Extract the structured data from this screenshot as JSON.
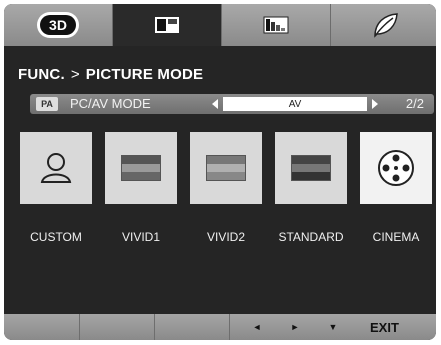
{
  "tabs": [
    {
      "icon": "3d-icon",
      "label": "3D",
      "active": false
    },
    {
      "icon": "picture-icon",
      "active": true
    },
    {
      "icon": "color-bars-icon",
      "active": false
    },
    {
      "icon": "eco-leaf-icon",
      "active": false
    }
  ],
  "breadcrumb": {
    "parent": "FUNC.",
    "separator": ">",
    "current": "PICTURE MODE"
  },
  "mode_row": {
    "badge": "PA",
    "label": "PC/AV MODE",
    "value": "AV",
    "page": "2/2"
  },
  "modes": [
    {
      "label": "CUSTOM",
      "icon": "person-icon",
      "selected": false
    },
    {
      "label": "VIVID1",
      "icon": "vivid1-swatch-icon",
      "selected": false
    },
    {
      "label": "VIVID2",
      "icon": "vivid2-swatch-icon",
      "selected": false
    },
    {
      "label": "STANDARD",
      "icon": "standard-swatch-icon",
      "selected": false
    },
    {
      "label": "CINEMA",
      "icon": "film-reel-icon",
      "selected": true
    }
  ],
  "bottom_bar": {
    "left_label": "◄",
    "right_label": "►",
    "down_label": "▼",
    "exit_label": "EXIT"
  },
  "colors": {
    "panel": "#252525",
    "bar": "#9a9a9a",
    "tile": "#d9d9d9",
    "tile_selected": "#f2f2f2"
  }
}
